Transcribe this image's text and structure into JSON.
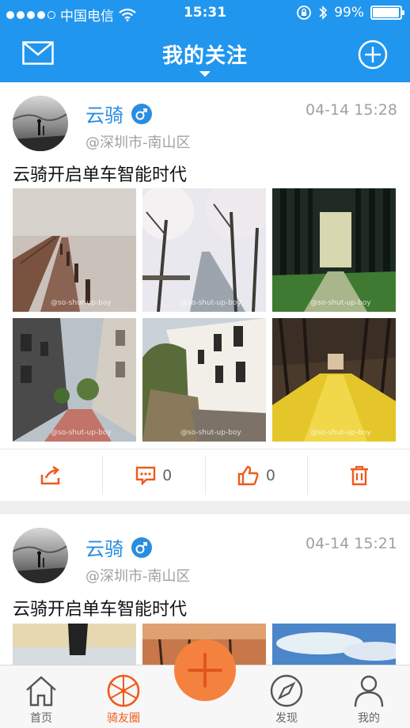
{
  "status_bar": {
    "carrier": "中国电信",
    "time": "15:31",
    "battery": "99%",
    "battery_level": 0.99
  },
  "nav": {
    "title": "我的关注"
  },
  "posts": [
    {
      "user": "云骑",
      "location": "@深圳市-南山区",
      "time": "04-14 15:28",
      "text": "云骑开启单车智能时代",
      "watermark": "@so-shut-up-boy",
      "comments": "0",
      "likes": "0"
    },
    {
      "user": "云骑",
      "location": "@深圳市-南山区",
      "time": "04-14 15:21",
      "text": "云骑开启单车智能时代"
    }
  ],
  "tabbar": {
    "home": "首页",
    "circle": "骑友圈",
    "discover": "发现",
    "mine": "我的"
  },
  "colors": {
    "primary": "#2196ee",
    "accent": "#f05a1a",
    "center_button": "#f5813f"
  }
}
